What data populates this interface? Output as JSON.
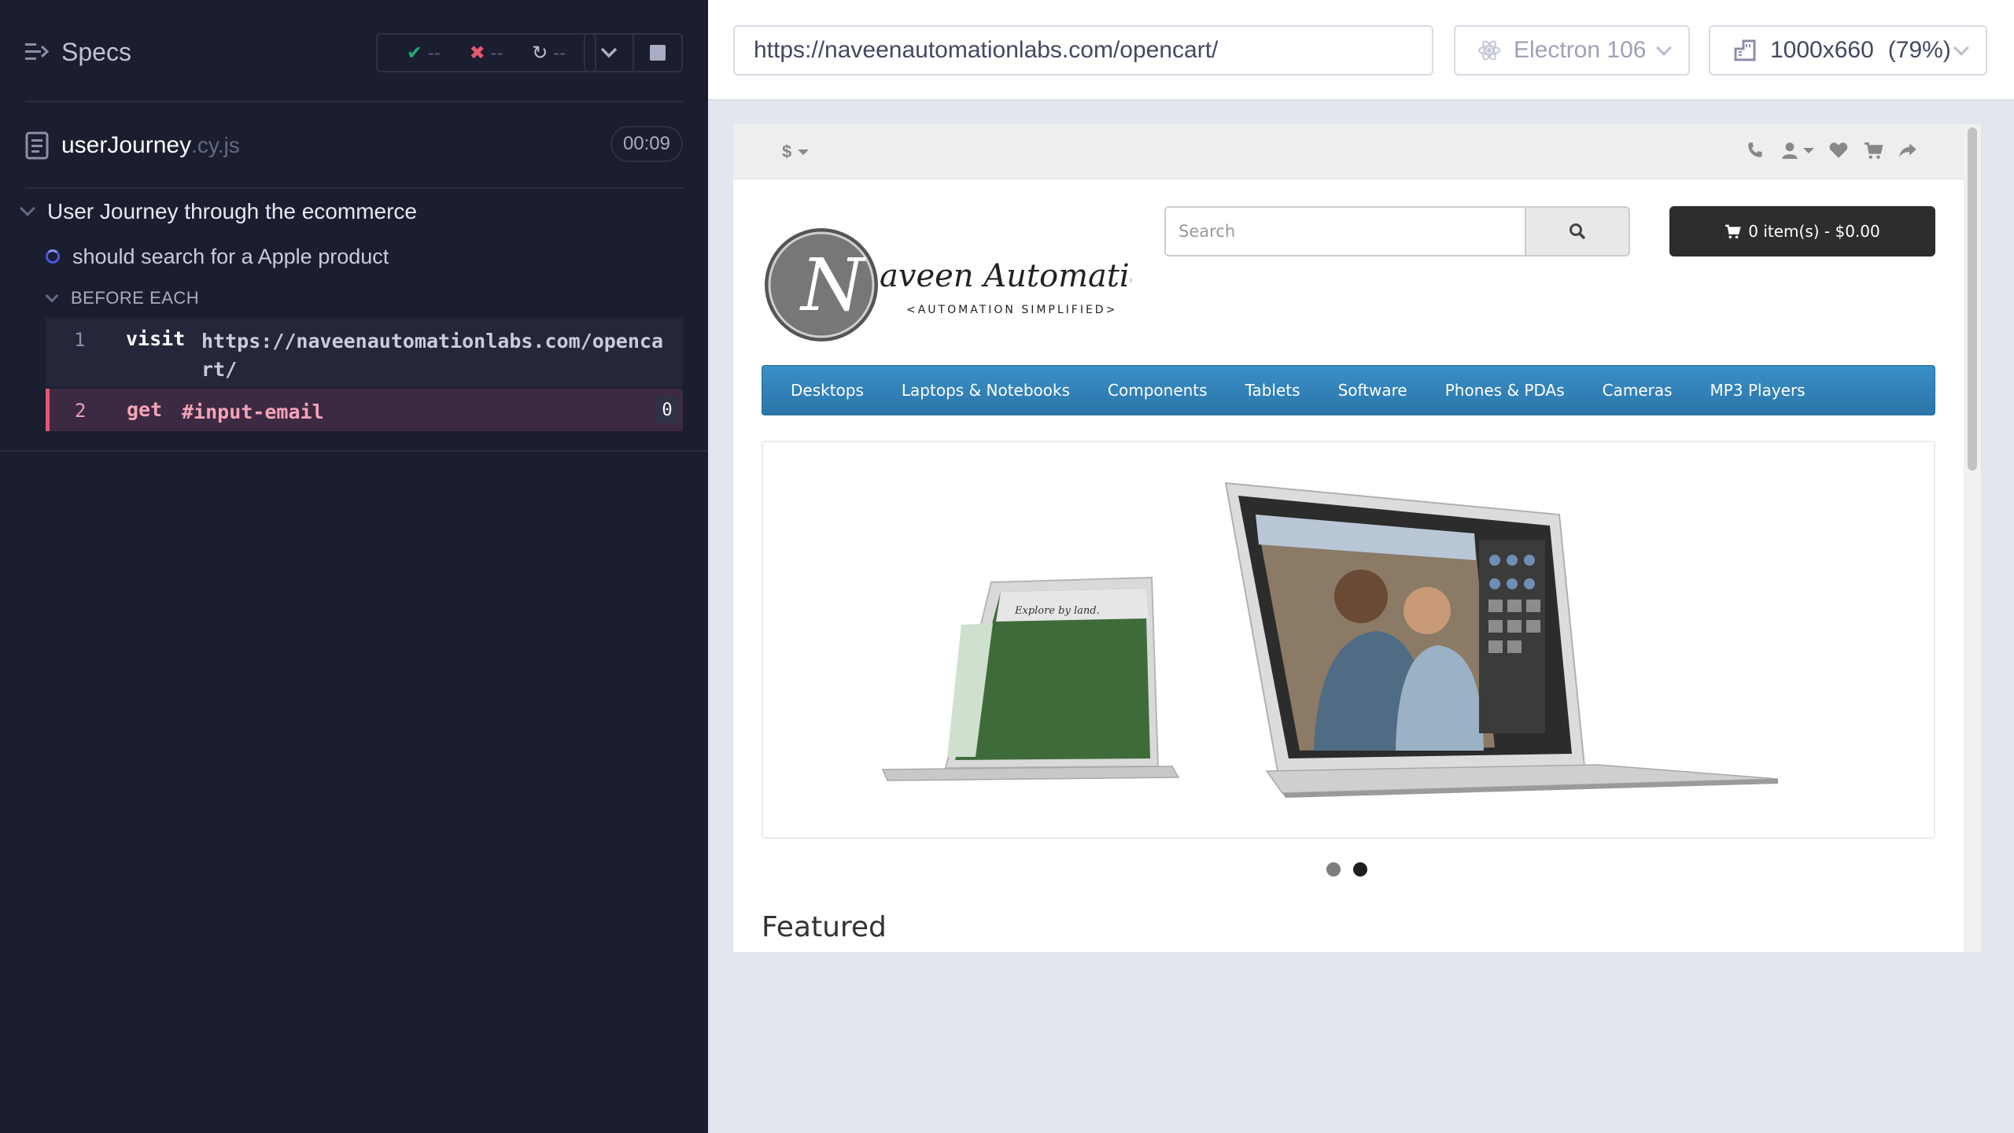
{
  "reporter": {
    "header": {
      "specs_label": "Specs"
    },
    "stats": {
      "passed": "--",
      "failed": "--",
      "pending": "--"
    },
    "spec": {
      "name": "userJourney",
      "ext": ".cy.js",
      "duration": "00:09"
    },
    "suite": {
      "title": "User Journey through the ecommerce",
      "test": {
        "title": "should search for a Apple product"
      },
      "hook": {
        "label": "BEFORE EACH"
      },
      "commands": [
        {
          "number": "1",
          "name": "visit",
          "message": "https://naveenautomationlabs.com/opencart/"
        },
        {
          "number": "2",
          "name": "get",
          "message": "#input-email",
          "count": "0"
        }
      ]
    }
  },
  "aut_header": {
    "url": "https://naveenautomationlabs.com/opencart/",
    "browser": "Electron 106",
    "viewport": "1000x660",
    "scale": "(79%)"
  },
  "store": {
    "currency": "$",
    "logo": {
      "title": "aveen Automation Labs",
      "tagline": "<AUTOMATION SIMPLIFIED>",
      "letter": "N"
    },
    "search": {
      "placeholder": "Search"
    },
    "cart": {
      "label": "0 item(s) - $0.00"
    },
    "menu": [
      "Desktops",
      "Laptops & Notebooks",
      "Components",
      "Tablets",
      "Software",
      "Phones & PDAs",
      "Cameras",
      "MP3 Players"
    ],
    "slide": {
      "screen_text": "Explore by land."
    },
    "featured_heading": "Featured"
  },
  "colors": {
    "reporter_bg": "#1b1e2e",
    "pass": "#1fa971",
    "fail": "#e45770",
    "menu_blue": "#2b75a9",
    "cart_dark": "#2d2d2d"
  }
}
